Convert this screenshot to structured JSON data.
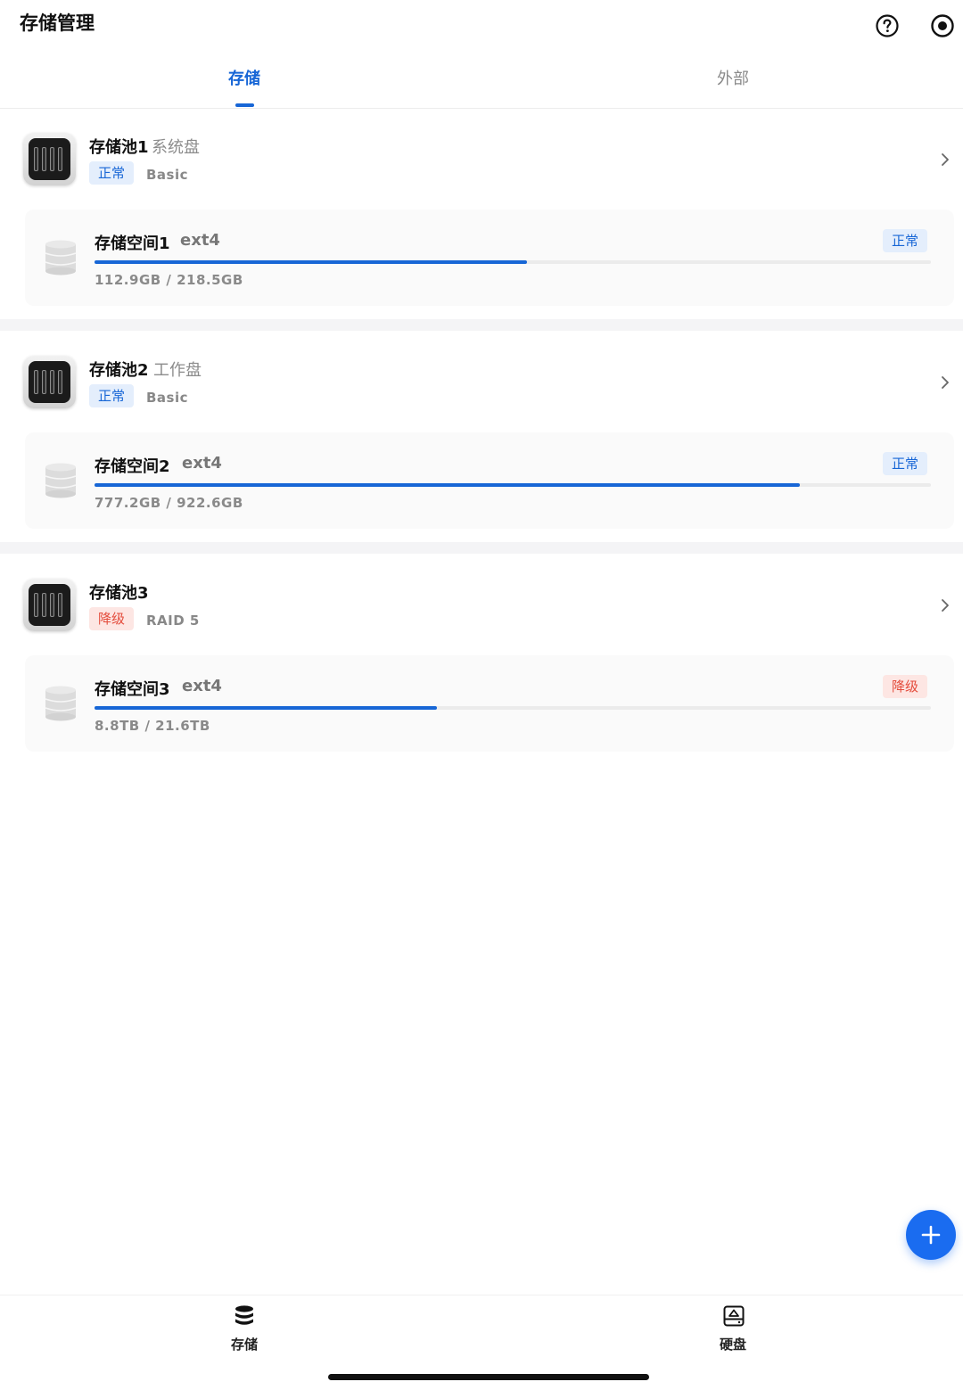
{
  "app": {
    "title": "存储管理"
  },
  "header": {
    "icons": [
      "help-circle-icon",
      "record-icon"
    ]
  },
  "tabs": [
    {
      "label": "存储",
      "active": true
    },
    {
      "label": "外部",
      "active": false
    }
  ],
  "pools": [
    {
      "name": "存储池1",
      "description": "系统盘",
      "status": "正常",
      "status_type": "ok",
      "raid": "Basic",
      "space": {
        "name": "存储空间1",
        "fs": "ext4",
        "status": "正常",
        "status_type": "ok",
        "usage": "112.9GB / 218.5GB",
        "used_fraction": 0.517
      }
    },
    {
      "name": "存储池2",
      "description": "工作盘",
      "status": "正常",
      "status_type": "ok",
      "raid": "Basic",
      "space": {
        "name": "存储空间2",
        "fs": "ext4",
        "status": "正常",
        "status_type": "ok",
        "usage": "777.2GB / 922.6GB",
        "used_fraction": 0.843
      }
    },
    {
      "name": "存储池3",
      "description": "",
      "status": "降级",
      "status_type": "warn",
      "raid": "RAID 5",
      "space": {
        "name": "存储空间3",
        "fs": "ext4",
        "status": "降级",
        "status_type": "warn",
        "usage": "8.8TB / 21.6TB",
        "used_fraction": 0.409
      }
    }
  ],
  "fab": {
    "icon": "plus-icon"
  },
  "bottom_nav": [
    {
      "label": "存储",
      "icon": "database-icon"
    },
    {
      "label": "硬盘",
      "icon": "hard-drive-icon"
    }
  ],
  "colors": {
    "accent": "#1766d6",
    "ok_bg": "#e4eefc",
    "warn": "#e44c3c",
    "warn_bg": "#fde6e3"
  }
}
